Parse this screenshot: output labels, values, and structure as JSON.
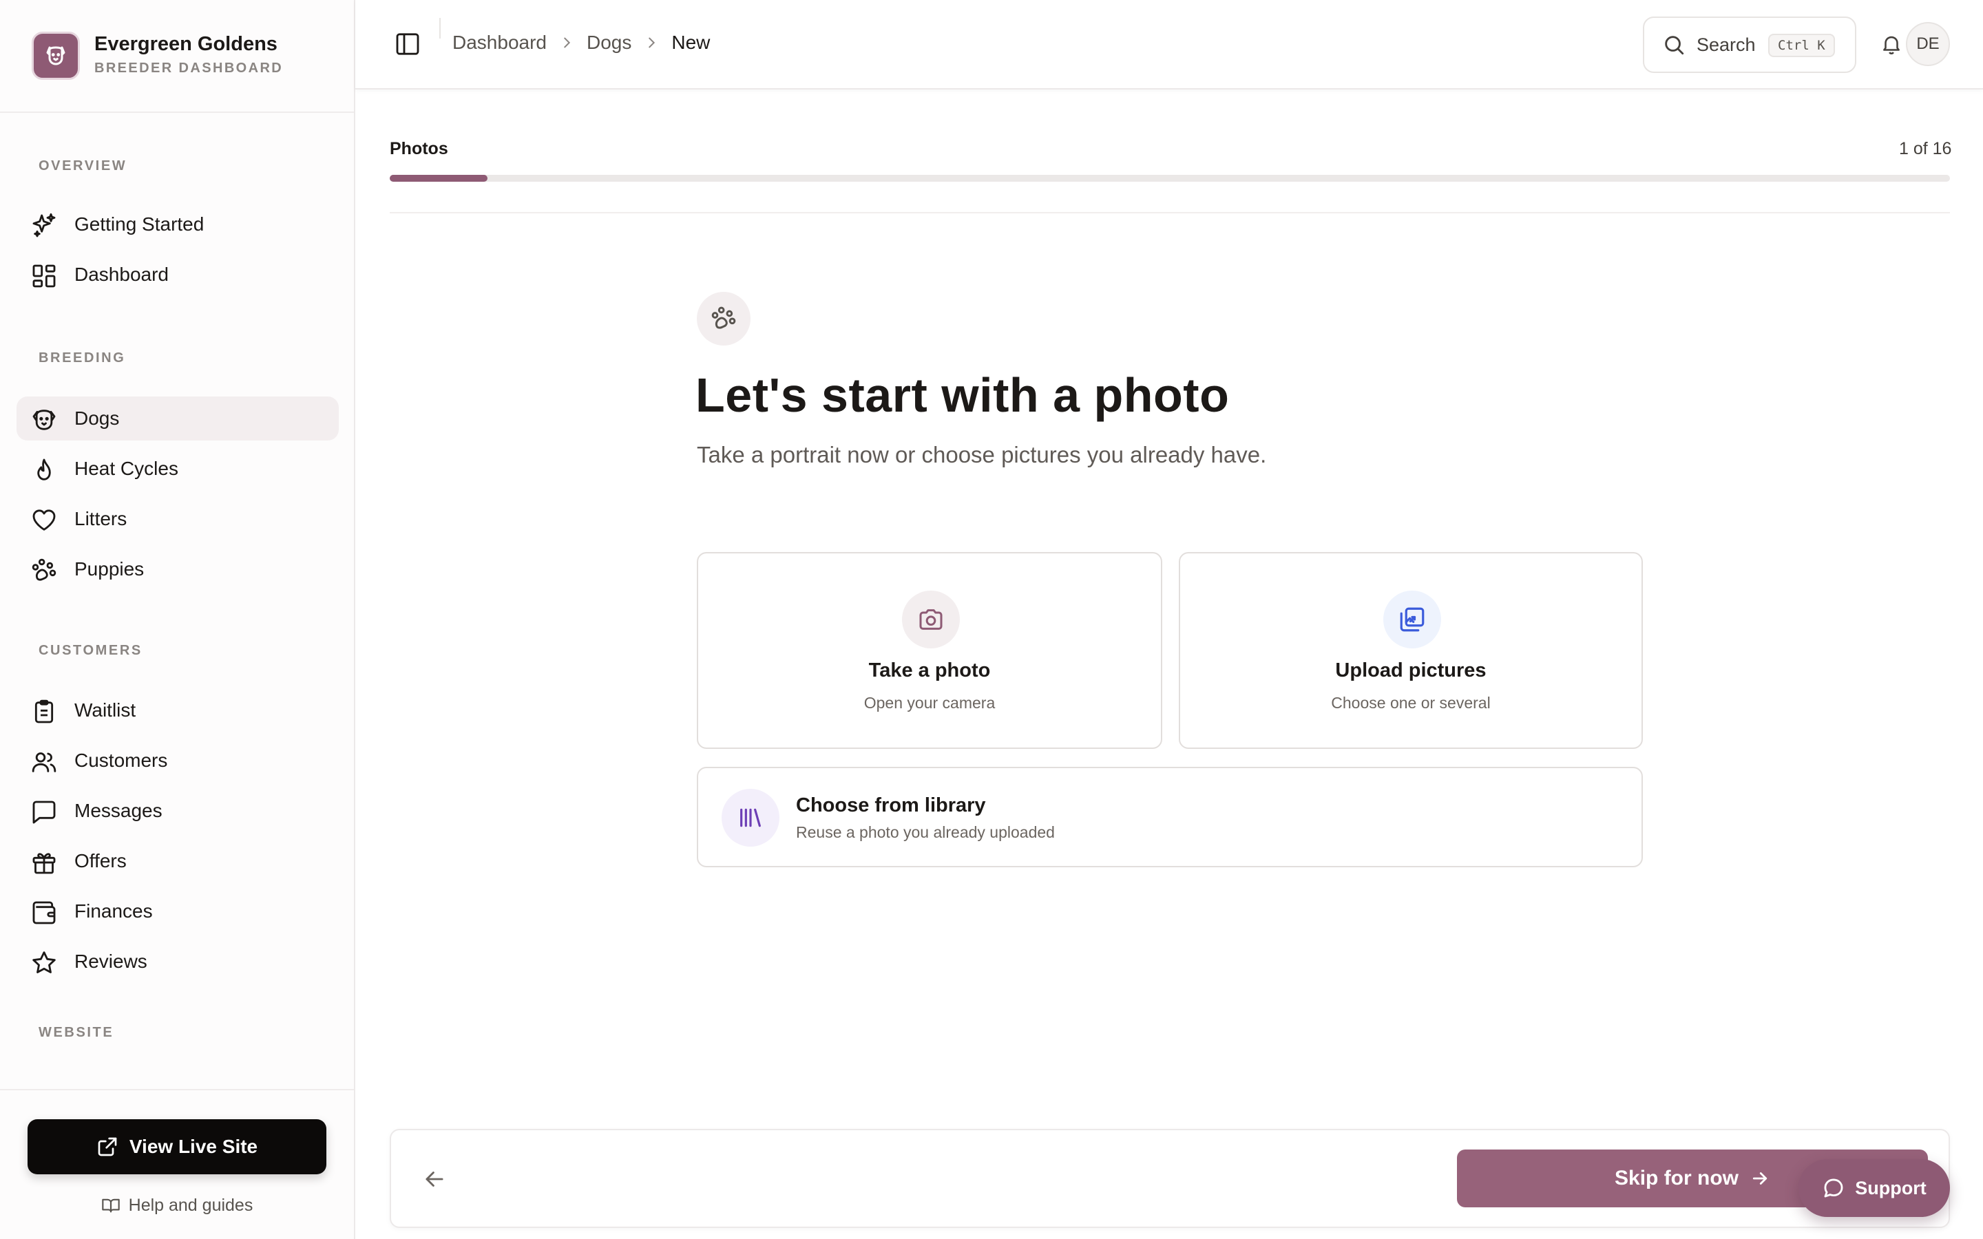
{
  "brand": {
    "name": "Evergreen Goldens",
    "subtitle": "BREEDER DASHBOARD"
  },
  "sidebar": {
    "sections": [
      {
        "title": "OVERVIEW",
        "items": [
          {
            "label": "Getting Started",
            "icon": "sparkles-icon"
          },
          {
            "label": "Dashboard",
            "icon": "layout-grid-icon"
          }
        ]
      },
      {
        "title": "BREEDING",
        "items": [
          {
            "label": "Dogs",
            "icon": "dog-icon",
            "active": true
          },
          {
            "label": "Heat Cycles",
            "icon": "flame-icon"
          },
          {
            "label": "Litters",
            "icon": "heart-icon"
          },
          {
            "label": "Puppies",
            "icon": "paw-icon"
          }
        ]
      },
      {
        "title": "CUSTOMERS",
        "items": [
          {
            "label": "Waitlist",
            "icon": "clipboard-icon"
          },
          {
            "label": "Customers",
            "icon": "users-icon"
          },
          {
            "label": "Messages",
            "icon": "message-square-icon"
          },
          {
            "label": "Offers",
            "icon": "gift-icon"
          },
          {
            "label": "Finances",
            "icon": "wallet-icon"
          },
          {
            "label": "Reviews",
            "icon": "star-icon"
          }
        ]
      },
      {
        "title": "WEBSITE",
        "items": []
      }
    ],
    "view_live_site": "View Live Site",
    "help": "Help and guides"
  },
  "topbar": {
    "breadcrumbs": [
      "Dashboard",
      "Dogs",
      "New"
    ],
    "search_label": "Search",
    "search_shortcut": "Ctrl K",
    "avatar_initials": "DE"
  },
  "wizard": {
    "step_label": "Photos",
    "step_count": "1 of 16",
    "progress_fraction": 0.0625,
    "title": "Let's start with a photo",
    "subtitle": "Take a portrait now or choose pictures you already have.",
    "options": {
      "camera": {
        "title": "Take a photo",
        "subtitle": "Open your camera"
      },
      "upload": {
        "title": "Upload pictures",
        "subtitle": "Choose one or several"
      },
      "library": {
        "title": "Choose from library",
        "subtitle": "Reuse a photo you already uploaded"
      }
    },
    "skip_label": "Skip for now"
  },
  "support_label": "Support",
  "colors": {
    "accent": "#8e5a74",
    "accent_button": "#97627a",
    "upload_icon": "#3b5bdb",
    "library_icon": "#6d3fb5"
  }
}
